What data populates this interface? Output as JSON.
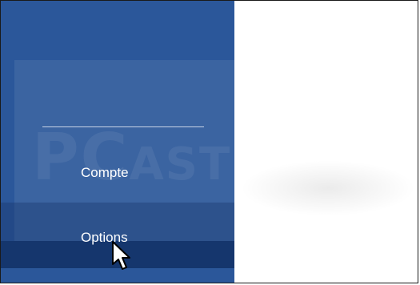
{
  "menu": {
    "items": [
      {
        "label": "Compte"
      },
      {
        "label": "Options"
      }
    ]
  },
  "watermark": {
    "brand_big": "PC",
    "brand_small": "ASTUCES"
  },
  "colors": {
    "sidebar": "#2b579a",
    "selected": "#163a72",
    "text": "#ffffff"
  }
}
